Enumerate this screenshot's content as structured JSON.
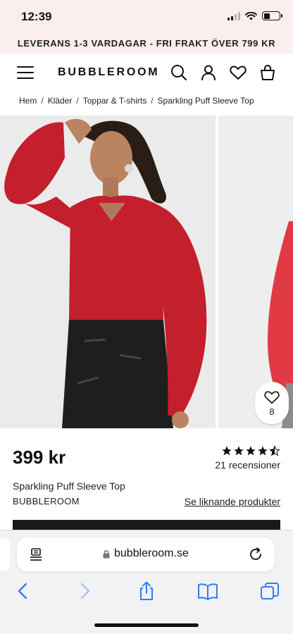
{
  "status_bar": {
    "time": "12:39"
  },
  "announcement": "LEVERANS 1-3 VARDAGAR - FRI FRAKT ÖVER 799 KR",
  "header": {
    "logo": "BUBBLEROOM",
    "icons": [
      "menu-icon",
      "search-icon",
      "account-icon",
      "wishlist-icon",
      "bag-icon"
    ]
  },
  "breadcrumb": [
    "Hem",
    "Kläder",
    "Toppar & T-shirts",
    "Sparkling Puff Sleeve Top"
  ],
  "gallery": {
    "favorite_count": "8"
  },
  "product": {
    "price": "399 kr",
    "rating": 4.5,
    "reviews": "21 recensioner",
    "name": "Sparkling Puff Sleeve Top",
    "brand": "BUBBLEROOM",
    "similar_link": "Se liknande produkter"
  },
  "browser": {
    "url": "bubbleroom.se"
  },
  "colors": {
    "accent_bg": "#fbeeee",
    "product_red": "#c41f2c",
    "text": "#1a1a1a"
  }
}
